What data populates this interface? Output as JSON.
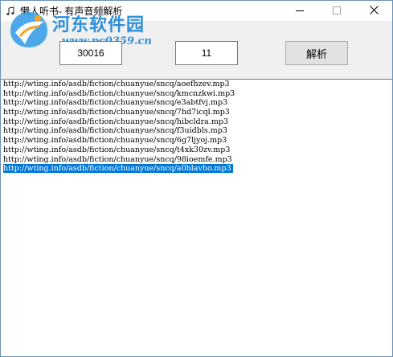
{
  "window": {
    "title": "懒人听书- 有声音频解析"
  },
  "watermark": {
    "title": "河东软件园",
    "url": "www.pc0359.cn"
  },
  "inputs": {
    "field_a": "30016",
    "field_b": "11"
  },
  "toolbar": {
    "parse_label": "解析"
  },
  "results": {
    "selected_index": 9,
    "items": [
      "http://wting.info/asdb/fiction/chuanyue/sncq/aoefhzev.mp3",
      "http://wting.info/asdb/fiction/chuanyue/sncq/kmcnzkwi.mp3",
      "http://wting.info/asdb/fiction/chuanyue/sncq/e3abtfvj.mp3",
      "http://wting.info/asdb/fiction/chuanyue/sncq/7hd7icql.mp3",
      "http://wting.info/asdb/fiction/chuanyue/sncq/hibcldra.mp3",
      "http://wting.info/asdb/fiction/chuanyue/sncq/f3uidbls.mp3",
      "http://wting.info/asdb/fiction/chuanyue/sncq/6g7ljyoj.mp3",
      "http://wting.info/asdb/fiction/chuanyue/sncq/t4xk30zv.mp3",
      "http://wting.info/asdb/fiction/chuanyue/sncq/98ioemfe.mp3",
      "http://wting.info/asdb/fiction/chuanyue/sncq/a0hlavho.mp3"
    ]
  },
  "colors": {
    "selection": "#0078d7",
    "watermark": "#2f8fd8"
  },
  "icons": {
    "app": "music-note-icon",
    "minimize": "minimize-icon",
    "maximize": "maximize-icon",
    "close": "close-icon"
  }
}
